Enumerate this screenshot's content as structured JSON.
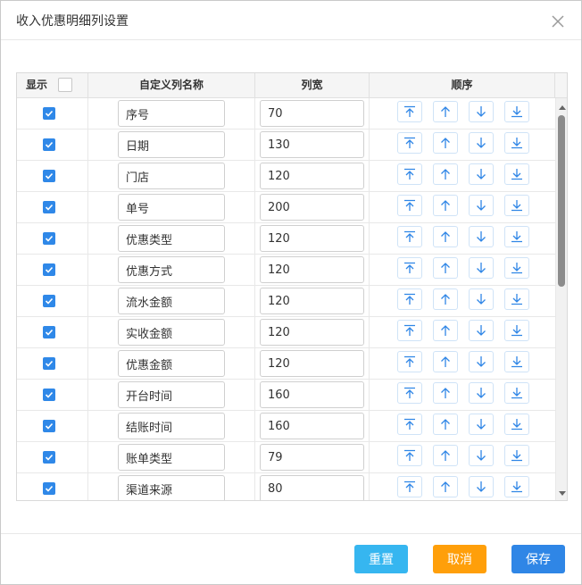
{
  "dialog": {
    "title": "收入优惠明细列设置"
  },
  "table": {
    "headers": {
      "show": "显示",
      "name": "自定义列名称",
      "width": "列宽",
      "order": "顺序"
    },
    "rows": [
      {
        "checked": true,
        "name": "序号",
        "width": "70"
      },
      {
        "checked": true,
        "name": "日期",
        "width": "130"
      },
      {
        "checked": true,
        "name": "门店",
        "width": "120"
      },
      {
        "checked": true,
        "name": "单号",
        "width": "200"
      },
      {
        "checked": true,
        "name": "优惠类型",
        "width": "120"
      },
      {
        "checked": true,
        "name": "优惠方式",
        "width": "120"
      },
      {
        "checked": true,
        "name": "流水金额",
        "width": "120"
      },
      {
        "checked": true,
        "name": "实收金额",
        "width": "120"
      },
      {
        "checked": true,
        "name": "优惠金额",
        "width": "120"
      },
      {
        "checked": true,
        "name": "开台时间",
        "width": "160"
      },
      {
        "checked": true,
        "name": "结账时间",
        "width": "160"
      },
      {
        "checked": true,
        "name": "账单类型",
        "width": "79"
      },
      {
        "checked": true,
        "name": "渠道来源",
        "width": "80"
      }
    ]
  },
  "footer": {
    "reset_label": "重置",
    "cancel_label": "取消",
    "save_label": "保存"
  },
  "colors": {
    "primary": "#2f86e6",
    "reset": "#36b6f0",
    "cancel": "#ff9f0a",
    "checkbox": "#2f88e8"
  },
  "icons": {
    "close": "close-icon",
    "move_top": "move-to-top-icon",
    "move_up": "arrow-up-icon",
    "move_down": "arrow-down-icon",
    "move_bottom": "move-to-bottom-icon"
  }
}
